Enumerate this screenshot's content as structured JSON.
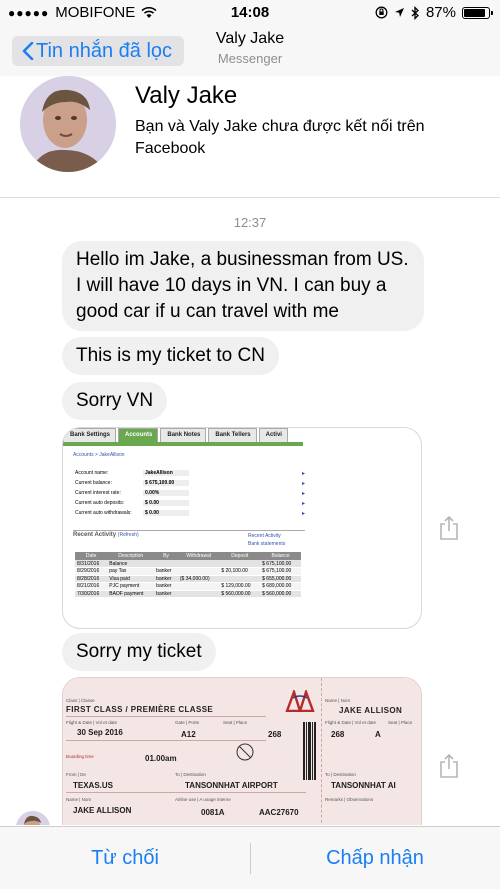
{
  "status_bar": {
    "carrier": "MOBIFONE",
    "time": "14:08",
    "battery": "87%",
    "battery_level": 0.87
  },
  "nav": {
    "back_label": "Tin nhắn đã lọc",
    "title": "Valy Jake",
    "subtitle": "Messenger"
  },
  "profile": {
    "name": "Valy Jake",
    "description": "Bạn và Valy Jake chưa được kết nối trên Facebook"
  },
  "chat": {
    "timestamp": "12:37",
    "messages": [
      {
        "text": "Hello im Jake,  a businessman from US. I will have 10 days in VN. I can buy a good car if u can travel with me"
      },
      {
        "text": "This is my ticket to CN"
      },
      {
        "text": "Sorry VN"
      },
      {
        "text": "Sorry my ticket"
      }
    ]
  },
  "bank_screenshot": {
    "tabs": [
      "Bank Settings",
      "Accounts",
      "Bank Notes",
      "Bank Tellers",
      "Activi"
    ],
    "breadcrumb": "Accounts > JakeAllison",
    "fields": [
      {
        "label": "Account name:",
        "value": "JakeAllison"
      },
      {
        "label": "Current balance:",
        "value": "$ 675,100.00"
      },
      {
        "label": "Current interest rate:",
        "value": "0.00%"
      },
      {
        "label": "Current auto deposits:",
        "value": "$ 0.00"
      },
      {
        "label": "Current auto withdrawals:",
        "value": "$ 0.00"
      }
    ],
    "recent_activity": "Recent Activity",
    "refresh": "(Refresh)",
    "links": [
      "Recent Activity",
      "Bank statements"
    ],
    "columns": [
      "Date",
      "Description",
      "By",
      "Withdrawal",
      "Deposit",
      "Balance"
    ],
    "rows": [
      [
        "8/31/2016",
        "Balance",
        "",
        "",
        "",
        "$ 675,100.00"
      ],
      [
        "8/29/2016",
        "pay Tax",
        "banker",
        "",
        "$ 20,100.00",
        "$ 675,100.00"
      ],
      [
        "8/28/2016",
        "Visa paid",
        "banker",
        "($ 34,000.00)",
        "",
        "$ 655,000.00"
      ],
      [
        "8/21/2016",
        "PJC payment",
        "banker",
        "",
        "$ 129,000.00",
        "$ 689,000.00"
      ],
      [
        "7/30/2016",
        "BAOF payment",
        "banker",
        "",
        "$ 560,000.00",
        "$ 560,000.00"
      ]
    ]
  },
  "ticket": {
    "class_label": "Class | Classe",
    "class_value": "FIRST CLASS / PREMIÈRE CLASSE",
    "logo": "AA",
    "name_label": "Name | Nom",
    "name_value": "JAKE ALLISON",
    "flight_date_label": "Flight & Date | Vol et date",
    "date_value": "30 Sep 2016",
    "gate_label": "Gate | Porte",
    "gate_value": "A12",
    "seat_label": "Seat | Place",
    "seat_value": "268",
    "seat_row": "A",
    "boarding_label": "Boarding time",
    "boarding_time": "01.00am",
    "from_label": "From | De",
    "from_value": "TEXAS.US",
    "to_label": "To | Destination",
    "to_value": "TANSONNHAT AIRPORT",
    "to_short": "TANSONNHAT AI",
    "airline_label": "Airline use | A usage interne",
    "flight_code": "0081A",
    "ref_code": "AAC27670",
    "remarks_label": "Remarks | Observations"
  },
  "bottom_bar": {
    "decline": "Từ chối",
    "accept": "Chấp nhận"
  },
  "colors": {
    "accent": "#1a7ef4",
    "bubble": "#f1f0f0",
    "bar": "#f7f7f7"
  },
  "icons": [
    "signal-dots-icon",
    "wifi-icon",
    "lock-rotation-icon",
    "location-icon",
    "bluetooth-icon",
    "battery-icon",
    "back-chevron-icon",
    "share-icon"
  ]
}
